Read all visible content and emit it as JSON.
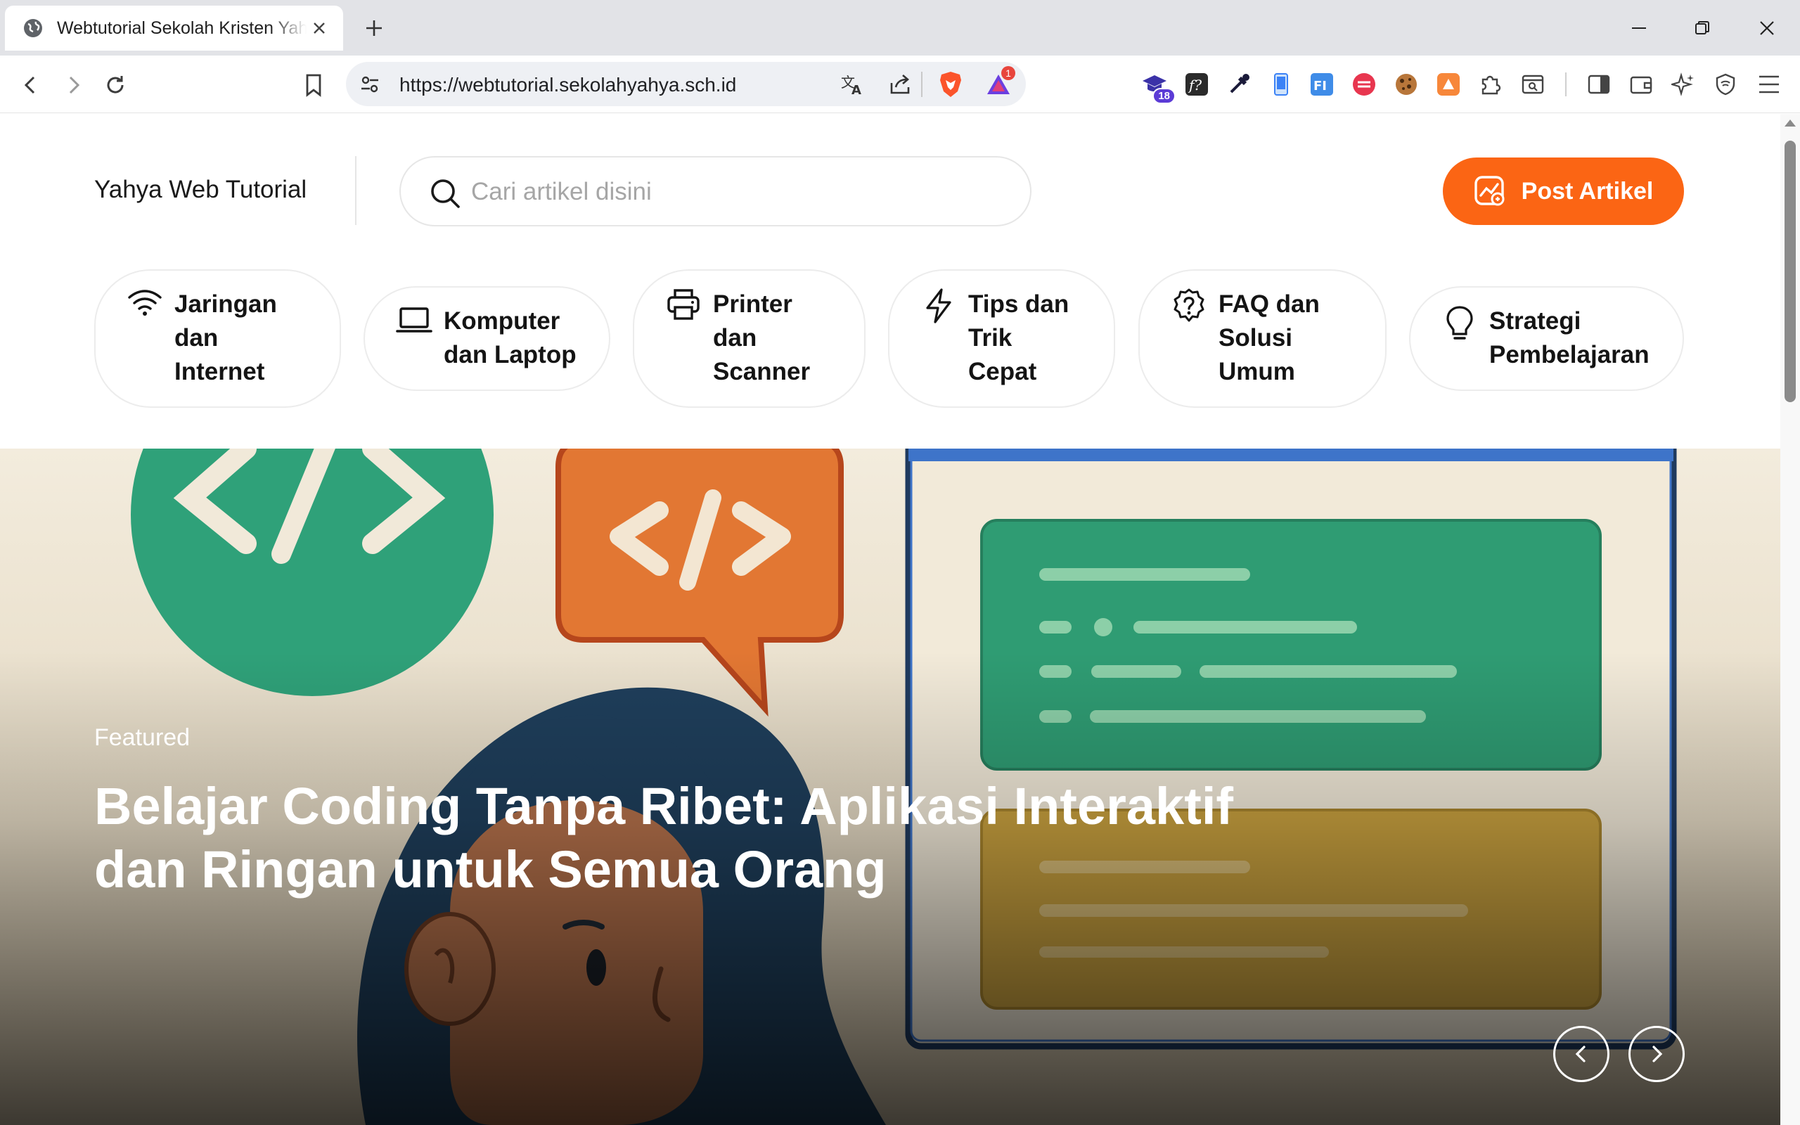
{
  "browser": {
    "tab_title": "Webtutorial Sekolah Kristen Yahya",
    "url": "https://webtutorial.sekolahyahya.sch.id",
    "extension_badge": "18",
    "alert_badge": "1"
  },
  "header": {
    "site_title": "Yahya Web Tutorial",
    "search_placeholder": "Cari artikel disini",
    "post_button_label": "Post Artikel"
  },
  "categories": [
    {
      "lines": [
        "Jaringan",
        "dan",
        "Internet"
      ],
      "icon": "wifi-icon"
    },
    {
      "lines": [
        "Komputer",
        "dan Laptop"
      ],
      "icon": "laptop-icon"
    },
    {
      "lines": [
        "Printer",
        "dan",
        "Scanner"
      ],
      "icon": "printer-icon"
    },
    {
      "lines": [
        "Tips dan",
        "Trik",
        "Cepat"
      ],
      "icon": "lightning-icon"
    },
    {
      "lines": [
        "FAQ dan",
        "Solusi",
        "Umum"
      ],
      "icon": "question-badge-icon"
    },
    {
      "lines": [
        "Strategi",
        "Pembelajaran"
      ],
      "icon": "lightbulb-icon"
    }
  ],
  "hero": {
    "kicker": "Featured",
    "title_line1": "Belajar Coding Tanpa Ribet: Aplikasi Interaktif",
    "title_line2": "dan Ringan untuk Semua Orang"
  },
  "colors": {
    "accent": "#fb6514",
    "tabbar": "#e2e3e7",
    "omnibox": "#eef0f4"
  }
}
